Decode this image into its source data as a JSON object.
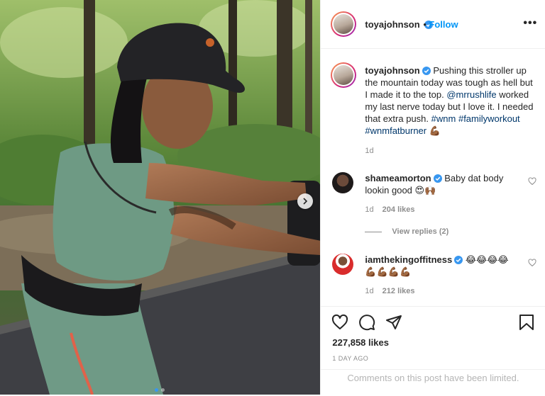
{
  "post": {
    "author": "toyajohnson",
    "follow_label": "Follow",
    "more_icon": "more-options-icon",
    "caption_text": "Pushing this stroller up the mountain today was tough as hell but I made it to the top.",
    "caption_mention": "@mrrushlife",
    "caption_text_2": "worked my last nerve today but I love it. I needed that extra push.",
    "hashtags": [
      "#wnm",
      "#familyworkout",
      "#wnmfatburner"
    ],
    "caption_emoji": "💪🏾",
    "caption_age": "1d",
    "like_count": "227,858 likes",
    "time_ago": "1 DAY AGO",
    "comments_notice": "Comments on this post have been limited.",
    "carousel": {
      "slides": 2,
      "current": 1
    }
  },
  "comments": [
    {
      "username": "shameamorton",
      "text": "Baby dat body lookin good 😍🙌🏾",
      "age": "1d",
      "likes": "204 likes",
      "view_replies": "View replies (2)"
    },
    {
      "username": "iamthekingoffitness",
      "text": "😂😂😂😂 💪🏾💪🏾💪🏾💪🏾",
      "age": "1d",
      "likes": "212 likes"
    }
  ],
  "colors": {
    "accent": "#0095f6",
    "verified": "#3897f0",
    "muted": "#8e8e8e",
    "border": "#efefef"
  },
  "icons": [
    "verified-badge-icon",
    "heart-icon",
    "comment-icon",
    "share-icon",
    "bookmark-icon",
    "chevron-right-icon"
  ]
}
